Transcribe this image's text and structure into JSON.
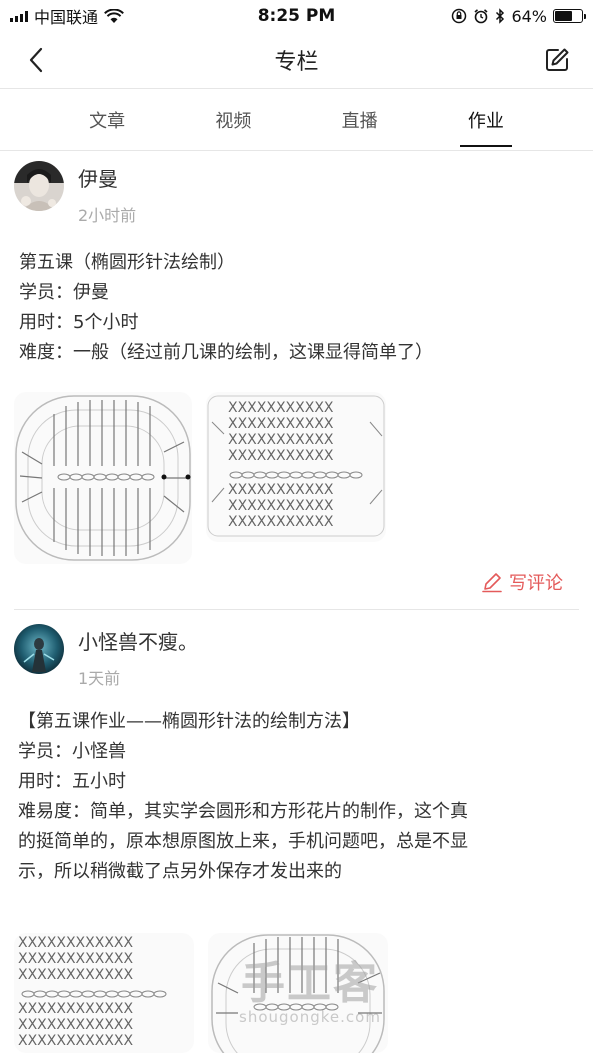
{
  "status_bar": {
    "carrier": "中国联通",
    "time": "8:25 PM",
    "battery": "64%",
    "battery_level": 0.64
  },
  "header": {
    "title": "专栏",
    "back_icon": "chevron-left-icon",
    "edit_icon": "edit-icon"
  },
  "tabs": [
    {
      "label": "文章",
      "active": false
    },
    {
      "label": "视频",
      "active": false
    },
    {
      "label": "直播",
      "active": false
    },
    {
      "label": "作业",
      "active": true
    }
  ],
  "posts": [
    {
      "author": "伊曼",
      "time": "2小时前",
      "lines": [
        "第五课（椭圆形针法绘制）",
        "学员：伊曼",
        "用时：5个小时",
        "难度：一般（经过前几课的绘制，这课显得简单了）"
      ],
      "comment_label": "写评论"
    },
    {
      "author": "小怪兽不瘦。",
      "time": "1天前",
      "lines": [
        "【第五课作业——椭圆形针法的绘制方法】",
        "学员：小怪兽",
        "用时：五小时",
        "难易度：简单，其实学会圆形和方形花片的制作，这个真",
        "的挺简单的，原本想原图放上来，手机问题吧，总是不显",
        "示，所以稍微截了点另外保存才发出来的"
      ]
    }
  ],
  "watermark": {
    "logo": "手工客",
    "url": "shougongke.com"
  }
}
